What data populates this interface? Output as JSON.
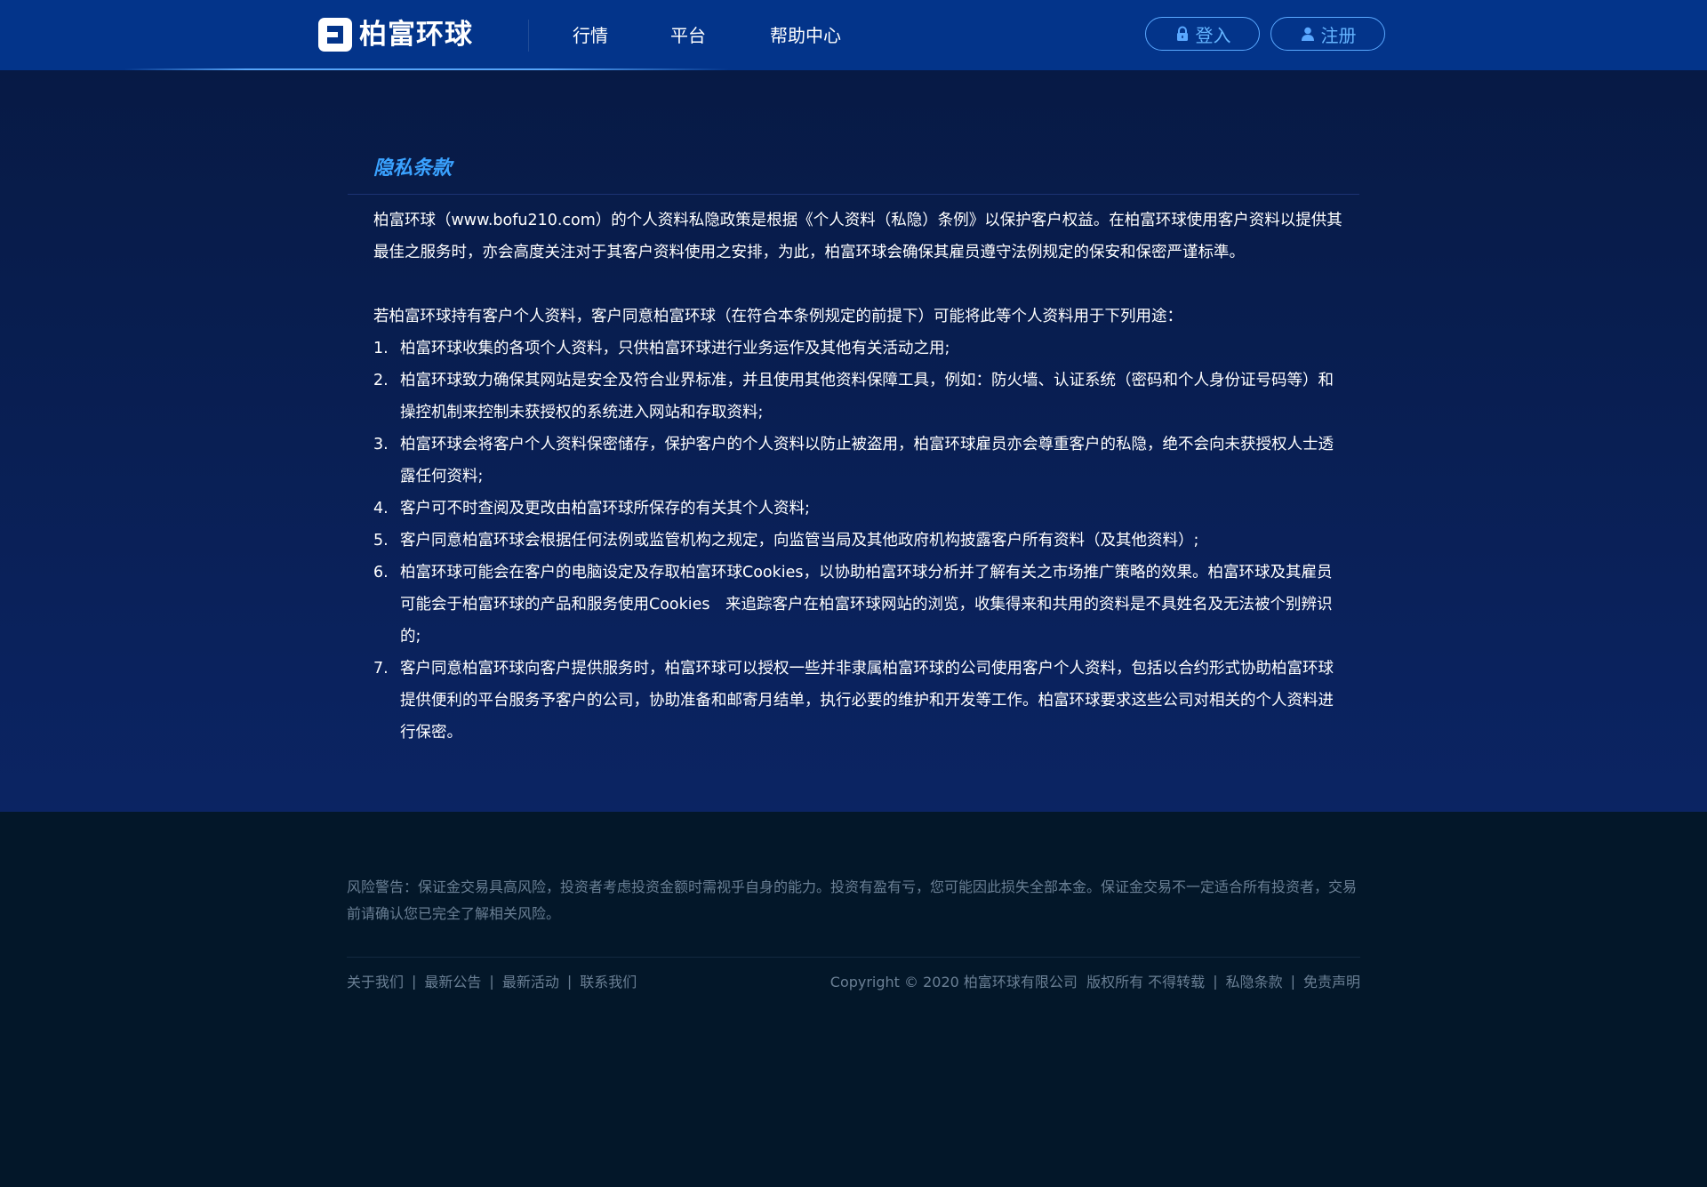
{
  "header": {
    "logo_text": "柏富环球",
    "nav": [
      "行情",
      "平台",
      "帮助中心"
    ],
    "login_label": "登入",
    "register_label": "注册"
  },
  "main": {
    "title": "隐私条款",
    "intro": "柏富环球（www.bofu210.com）的个人资料私隐政策是根据《个人资料（私隐）条例》以保护客户权益。在柏富环球使用客户资料以提供其最佳之服务时，亦会高度关注对于其客户资料使用之安排，为此，柏富环球会确保其雇员遵守法例规定的保安和保密严谨标準。",
    "lead": "若柏富环球持有客户个人资料，客户同意柏富环球（在符合本条例规定的前提下）可能将此等个人资料用于下列用途：",
    "items": [
      {
        "num": "1.",
        "text": "柏富环球收集的各项个人资料，只供柏富环球进行业务运作及其他有关活动之用;"
      },
      {
        "num": "2.",
        "text": "柏富环球致力确保其网站是安全及符合业界标准，并且使用其他资料保障工具，例如：防火墙、认证系统（密码和个人身份证号码等）和操控机制来控制未获授权的系统进入网站和存取资料;"
      },
      {
        "num": "3.",
        "text": "柏富环球会将客户个人资料保密储存，保护客户的个人资料以防止被盗用，柏富环球雇员亦会尊重客户的私隐，绝不会向未获授权人士透露任何资料;"
      },
      {
        "num": "4.",
        "text": "客户可不时查阅及更改由柏富环球所保存的有关其个人资料;"
      },
      {
        "num": "5.",
        "text": "客户同意柏富环球会根据任何法例或监管机构之规定，向监管当局及其他政府机构披露客户所有资料（及其他资料）;"
      },
      {
        "num": "6.",
        "text": "柏富环球可能会在客户的电脑设定及存取柏富环球Cookies，以协助柏富环球分析并了解有关之市场推广策略的效果。柏富环球及其雇员可能会于柏富环球的产品和服务使用Cookies　来追踪客户在柏富环球网站的浏览，收集得来和共用的资料是不具姓名及无法被个别辨识的;"
      },
      {
        "num": "7.",
        "text": "客户同意柏富环球向客户提供服务时，柏富环球可以授权一些并非隶属柏富环球的公司使用客户个人资料，包括以合约形式协助柏富环球提供便利的平台服务予客户的公司，协助准备和邮寄月结单，执行必要的维护和开发等工作。柏富环球要求这些公司对相关的个人资料进行保密。"
      }
    ]
  },
  "footer": {
    "risk_warning": "风险警告：保证金交易具高风险，投资者考虑投资金额时需视乎自身的能力。投资有盈有亏，您可能因此损失全部本金。保证金交易不一定适合所有投资者，交易前请确认您已完全了解相关风险。",
    "links": [
      "关于我们",
      "最新公告",
      "最新活动",
      "联系我们"
    ],
    "copyright": "Copyright © 2020 柏富环球有限公司  版权所有 不得转载",
    "privacy_link": "私隐条款",
    "disclaimer_link": "免责声明",
    "separator": "|"
  },
  "colors": {
    "header_bg": "#03348a",
    "accent": "#3aa2ff",
    "content_bg": "#0b2463",
    "footer_bg": "#031729"
  },
  "icons": {
    "login": "lock-icon",
    "register": "user-icon",
    "logo": "logo-mark-icon"
  }
}
